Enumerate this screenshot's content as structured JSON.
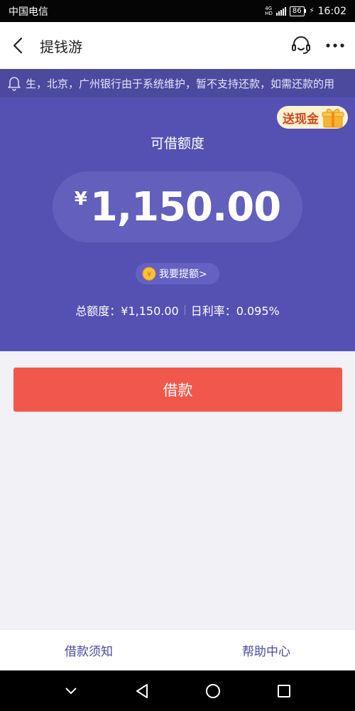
{
  "status_bar": {
    "carrier": "中国电信",
    "network_top": "4G",
    "network_bottom": "HD",
    "battery": "86",
    "time": "16:02"
  },
  "header": {
    "title": "提钱游"
  },
  "notice": {
    "text": "生，北京，广州银行由于系统维护，暂不支持还款，如需还款的用"
  },
  "hero": {
    "cash_badge_label": "送现金",
    "limit_title": "可借额度",
    "currency_symbol": "¥",
    "amount": "1,150.00",
    "raise_label": "我要提额>",
    "total_limit": "总额度：¥1,150.00",
    "daily_rate": "日利率：0.095%"
  },
  "borrow_button": "借款",
  "bottom_links": {
    "left": "借款须知",
    "right": "帮助中心"
  },
  "colors": {
    "hero_bg": "#5551b3",
    "notice_bg": "#4c4a9e",
    "borrow_button": "#f2574b",
    "link": "#4b4aa0"
  }
}
